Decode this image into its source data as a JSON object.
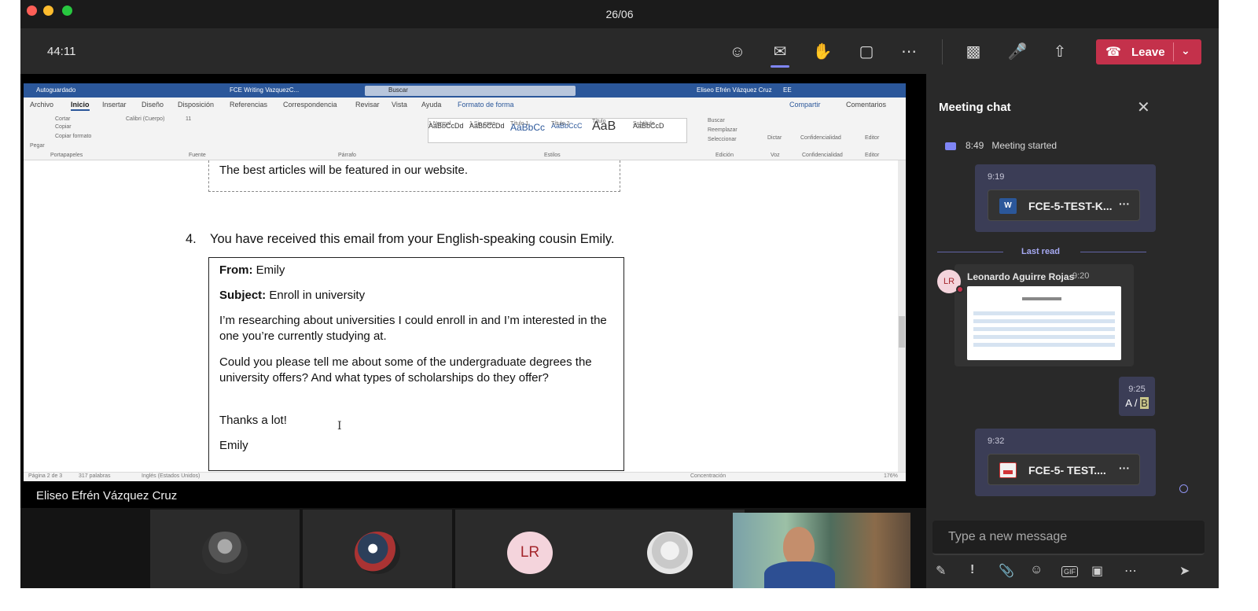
{
  "window": {
    "title": "26/06"
  },
  "teams": {
    "timer": "44:11",
    "icons": [
      "people-icon",
      "chat-icon",
      "reactions-icon",
      "rooms-icon",
      "more-icon",
      "camera-off-icon",
      "mic-off-icon",
      "share-icon"
    ],
    "leave_label": "Leave",
    "accent": "#7f85f5",
    "leave_color": "#c4314b"
  },
  "word": {
    "titlebar": {
      "autosave": "Autoguardado",
      "doc_name": "FCE Writing VazquezC...",
      "search": "Buscar",
      "user": "Eliseo Efrén Vázquez Cruz",
      "user_initials": "EE"
    },
    "menu": [
      "Archivo",
      "Inicio",
      "Insertar",
      "Diseño",
      "Disposición",
      "Referencias",
      "Correspondencia",
      "Revisar",
      "Vista",
      "Ayuda",
      "Formato de forma"
    ],
    "share": "Compartir",
    "comments": "Comentarios",
    "ribbon": {
      "paste": "Pegar",
      "cut": "Cortar",
      "copy": "Copiar",
      "format_painter": "Copiar formato",
      "font": "Calibri (Cuerpo)",
      "size": "11",
      "styles": [
        {
          "preview": "AaBbCcDd",
          "name": "1 Normal"
        },
        {
          "preview": "AaBbCcDd",
          "name": "1 Sin espa..."
        },
        {
          "preview": "AaBbCc",
          "name": "Título 1"
        },
        {
          "preview": "AaBbCcC",
          "name": "Título 2"
        },
        {
          "preview": "AaB",
          "name": "Título"
        },
        {
          "preview": "AaBbCcD",
          "name": "Subtítulo"
        }
      ],
      "find": "Buscar",
      "replace": "Reemplazar",
      "select": "Seleccionar",
      "dictate": "Dictar",
      "sensitivity": "Confidencialidad",
      "editor": "Editor",
      "groups": [
        "Portapapeles",
        "Fuente",
        "Párrafo",
        "Estilos",
        "Edición",
        "Voz",
        "Confidencialidad",
        "Editor"
      ]
    },
    "doc": {
      "prev_line": "The best articles will be featured in our website.",
      "q_num": "4.",
      "q_text": "You have received this email from your English-speaking cousin Emily.",
      "from_label": "From:",
      "from_value": "Emily",
      "subject_label": "Subject:",
      "subject_value": "Enroll in university",
      "p1": "I’m researching about universities I could enroll in and I’m interested in the one you’re currently studying at.",
      "p2": "Could you please tell me about some of the undergraduate degrees the university offers? And what types of scholarships do they offer?",
      "p3": "Thanks a lot!",
      "p4": "Emily"
    },
    "status": {
      "page": "Página 2 de 3",
      "words": "317 palabras",
      "lang": "Inglés (Estados Unidos)",
      "focus": "Concentración",
      "zoom": "176%"
    }
  },
  "presenter": {
    "name": "Eliseo Efrén Vázquez Cruz"
  },
  "participants": [
    {
      "initials": ""
    },
    {
      "initials": ""
    },
    {
      "initials": "LR"
    },
    {
      "initials": ""
    }
  ],
  "chat": {
    "title": "Meeting chat",
    "event_time": "8:49",
    "event_text": "Meeting started",
    "msg1_time": "9:19",
    "file1": "FCE-5-TEST-K...",
    "last_read": "Last read",
    "sender_initials": "LR",
    "sender_name": "Leonardo Aguirre Rojas",
    "sender_time": "9:20",
    "msg2_time": "9:25",
    "msg2_text_a": "A / ",
    "msg2_text_b": "B",
    "msg3_time": "9:32",
    "file2": "FCE-5- TEST....",
    "more": "···",
    "placeholder": "Type a new message"
  }
}
